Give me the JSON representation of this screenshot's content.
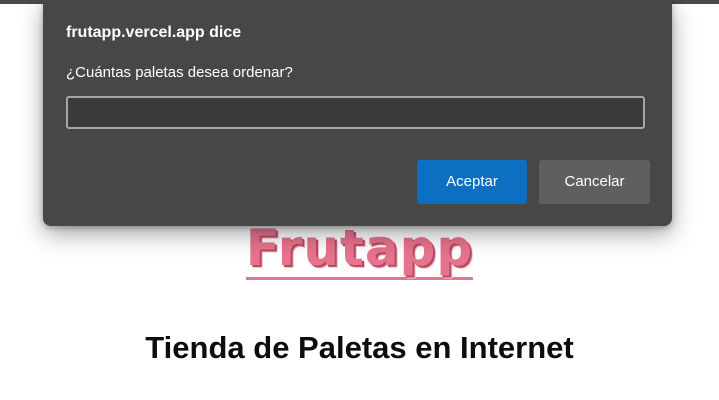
{
  "background_page": {
    "logo_text": "Frutapp",
    "heading": "Tienda de Paletas en Internet"
  },
  "dialog": {
    "origin": "frutapp.vercel.app dice",
    "message": "¿Cuántas paletas desea ordenar?",
    "input": {
      "value": "",
      "placeholder": ""
    },
    "buttons": {
      "accept_label": "Aceptar",
      "cancel_label": "Cancelar"
    }
  },
  "colors": {
    "dialog_background": "#474747",
    "accept_button": "#0c6fc2",
    "cancel_button": "#5f5f5f",
    "logo_pink": "#e7738e"
  }
}
